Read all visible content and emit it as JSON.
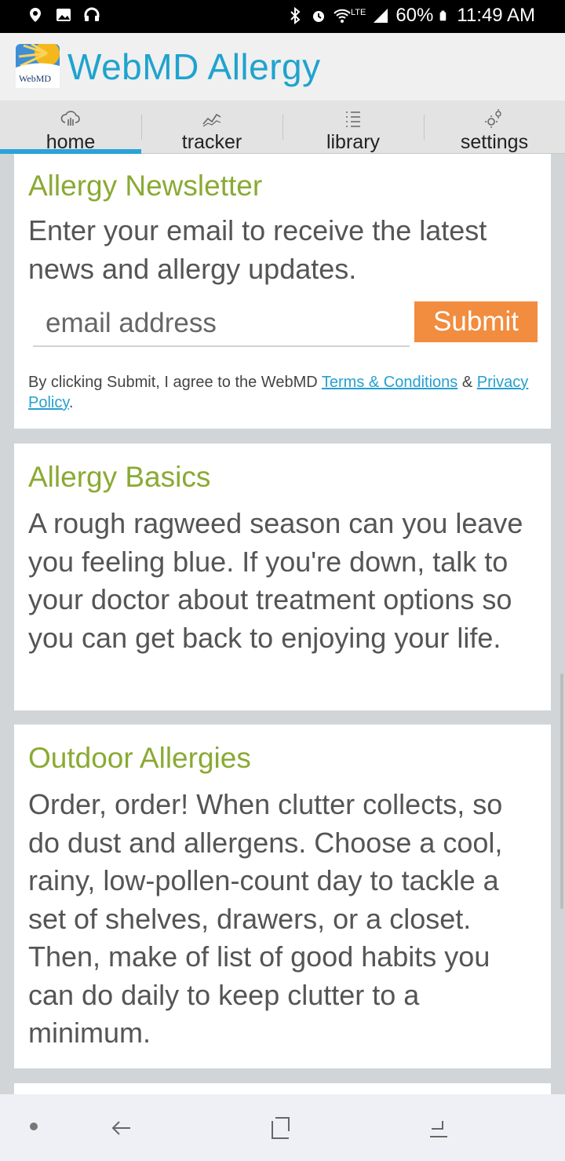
{
  "status_bar": {
    "battery": "60%",
    "time": "11:49 AM",
    "network": "LTE"
  },
  "header": {
    "logo_text": "WebMD",
    "title": "WebMD Allergy",
    "title_color": "#1fa3cf"
  },
  "tabs": [
    {
      "label": "home",
      "icon": "cloud-icon",
      "active": true
    },
    {
      "label": "tracker",
      "icon": "trend-icon",
      "active": false
    },
    {
      "label": "library",
      "icon": "list-icon",
      "active": false
    },
    {
      "label": "settings",
      "icon": "gears-icon",
      "active": false
    }
  ],
  "newsletter": {
    "title": "Allergy Newsletter",
    "description": "Enter your email to receive the latest news and allergy updates.",
    "email_placeholder": "email address",
    "email_value": "",
    "submit_label": "Submit",
    "fine_print_prefix": "By clicking Submit, I agree to the WebMD ",
    "terms_link": "Terms & Conditions",
    "fine_print_mid": " & ",
    "privacy_link": "Privacy Policy",
    "fine_print_suffix": "."
  },
  "cards": [
    {
      "title": "Allergy Basics",
      "body": "A rough ragweed season can you leave you feeling blue. If you're down, talk to your doctor about treatment options so you can get back to enjoying your life."
    },
    {
      "title": "Outdoor Allergies",
      "body": "Order, order! When clutter collects, so do dust and allergens. Choose a cool, rainy, low-pollen-count day to tackle a set of shelves, drawers, or a closet. Then, make of list of good habits you can do daily to keep clutter to a minimum."
    }
  ],
  "colors": {
    "accent_blue": "#2aa3d8",
    "card_title_green": "#8aaa33",
    "submit_orange": "#f28c3e",
    "page_background": "#d2d5d8"
  }
}
